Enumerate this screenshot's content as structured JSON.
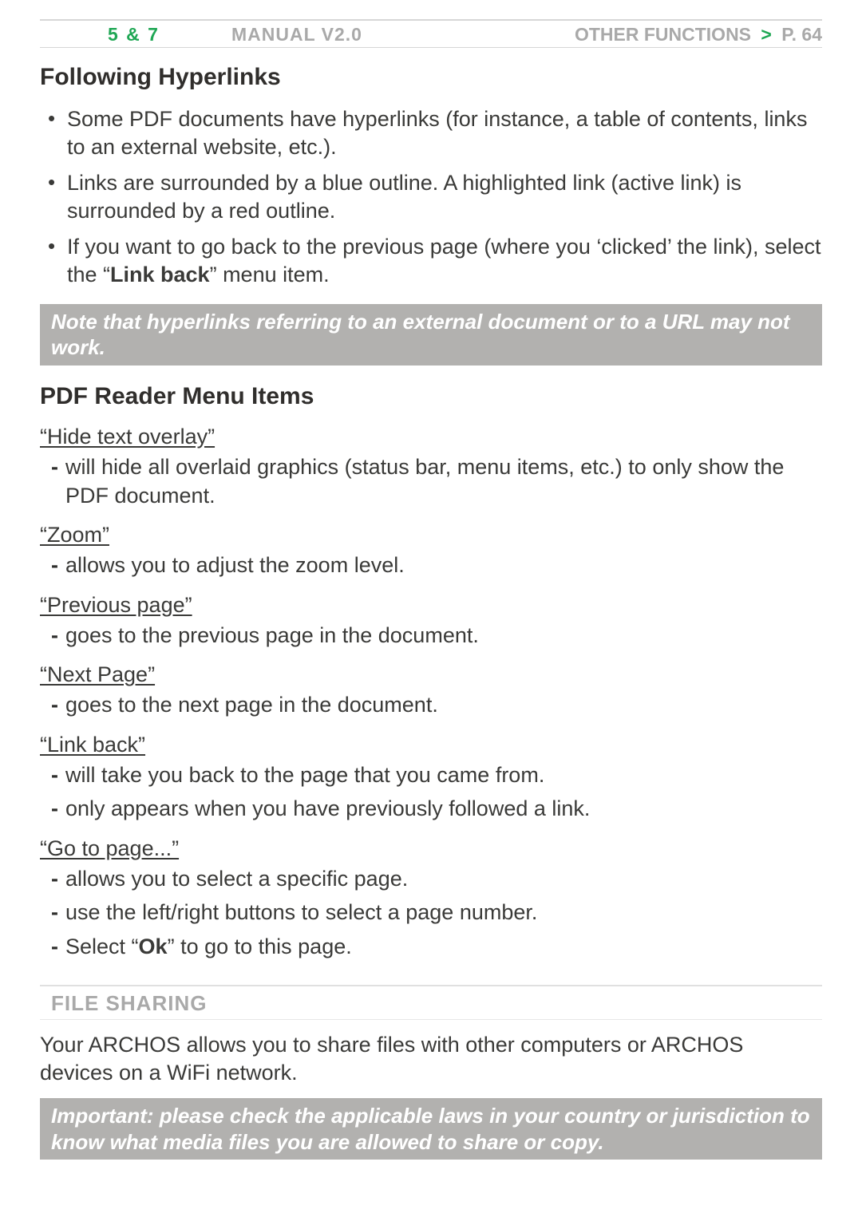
{
  "header": {
    "product": "5 & 7",
    "manual": "MANUAL V2.0",
    "breadcrumb_section": "OTHER FUNCTIONS",
    "gt": ">",
    "page_label": "P. 64"
  },
  "s1": {
    "title": "Following Hyperlinks",
    "bullets": [
      "Some PDF documents have hyperlinks (for instance, a table of contents, links to an external website, etc.).",
      "Links are surrounded by a blue outline. A highlighted link (active link) is surrounded by a red outline.",
      {
        "pre": "If you want to go back to the previous page (where you ‘clicked’ the link), select the “",
        "bold": "Link back",
        "post": "” menu item."
      }
    ],
    "note": "Note that hyperlinks referring to an external document or to a URL may not work."
  },
  "s2": {
    "title": "PDF Reader Menu Items",
    "items": [
      {
        "name": "“Hide text overlay”",
        "dashes": [
          "will hide all overlaid graphics (status bar, menu items, etc.) to only show the PDF document."
        ]
      },
      {
        "name": "“Zoom”",
        "dashes": [
          "allows you to adjust the zoom level."
        ]
      },
      {
        "name": "“Previous page”",
        "dashes": [
          "goes to the previous page in the document."
        ]
      },
      {
        "name": "“Next Page”",
        "dashes": [
          "goes to the next page in the document."
        ]
      },
      {
        "name": "“Link back”",
        "dashes": [
          "will take you back to the page that you came from.",
          "only appears when you have previously followed a link."
        ]
      },
      {
        "name": "“Go to page...”",
        "dashes": [
          "allows you to select a specific page.",
          "use the left/right buttons to select a page number.",
          {
            "pre": "Select “",
            "bold": "Ok",
            "post": "” to go to this page."
          }
        ]
      }
    ]
  },
  "s3": {
    "title": "FILE SHARING",
    "body": "Your ARCHOS allows you to share files with other computers or ARCHOS devices on a WiFi network.",
    "note": "Important: please check the applicable laws in your country or jurisdiction to know what media files you are allowed to share or copy."
  }
}
